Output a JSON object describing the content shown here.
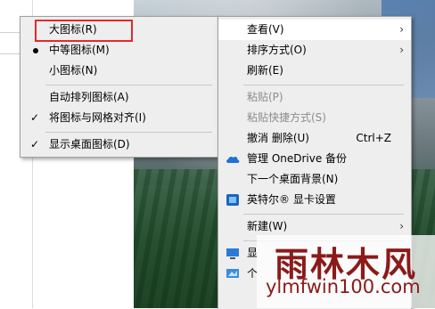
{
  "view_menu": {
    "items": [
      {
        "label": "大图标(R)",
        "mark": "",
        "highlighted": true
      },
      {
        "label": "中等图标(M)",
        "mark": "bullet"
      },
      {
        "label": "小图标(N)",
        "mark": ""
      },
      {
        "label": "自动排列图标(A)",
        "mark": ""
      },
      {
        "label": "将图标与网格对齐(I)",
        "mark": "check"
      },
      {
        "label": "显示桌面图标(D)",
        "mark": "check"
      }
    ]
  },
  "context_menu": {
    "items": [
      {
        "label": "查看(V)",
        "submenu": true,
        "active": true
      },
      {
        "label": "排序方式(O)",
        "submenu": true
      },
      {
        "label": "刷新(E)"
      },
      {
        "label": "粘贴(P)",
        "disabled": true
      },
      {
        "label": "粘贴快捷方式(S)",
        "disabled": true
      },
      {
        "label": "撤消 删除(U)",
        "shortcut": "Ctrl+Z"
      },
      {
        "label": "管理 OneDrive 备份",
        "icon": "onedrive-cloud-icon"
      },
      {
        "label": "下一个桌面背景(N)"
      },
      {
        "label": "英特尔® 显卡设置",
        "icon": "intel-graphics-icon"
      },
      {
        "label": "新建(W)",
        "submenu": true
      },
      {
        "label": "显",
        "icon": "display-settings-icon"
      },
      {
        "label": "个",
        "icon": "personalize-icon"
      }
    ]
  },
  "watermark": {
    "title": "雨林木风",
    "url": "ylmfwin100.com"
  },
  "colors": {
    "menu_bg": "#eeeeee",
    "highlight_border": "#e32a2a",
    "watermark": "#8b1a1a",
    "onedrive": "#1e73d2"
  }
}
